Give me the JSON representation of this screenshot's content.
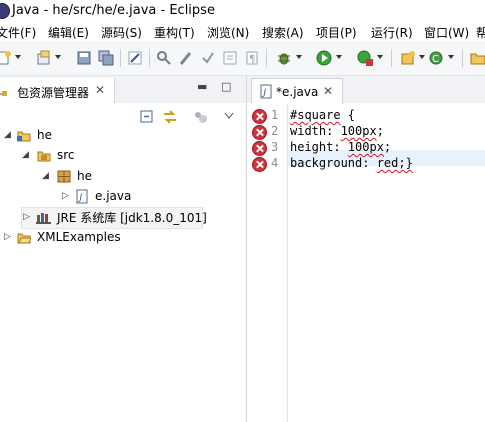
{
  "window": {
    "title": "Java - he/src/he/e.java - Eclipse"
  },
  "menu": [
    "文件(F)",
    "编辑(E)",
    "源码(S)",
    "重构(T)",
    "浏览(N)",
    "搜索(A)",
    "项目(P)",
    "运行(R)",
    "窗口(W)",
    "帮"
  ],
  "package_explorer": {
    "tab_label": "包资源管理器",
    "tree": {
      "project": "he",
      "src": "src",
      "package": "he",
      "file": "e.java",
      "jre": "JRE 系统库 [jdk1.8.0_101]",
      "other_project": "XMLExamples"
    }
  },
  "editor": {
    "tab_label": "*e.java",
    "lines": [
      {
        "num": "1",
        "pre": "",
        "squig": "#square",
        "post": " {"
      },
      {
        "num": "2",
        "pre": "width: ",
        "squig": "100px",
        "post": ";"
      },
      {
        "num": "3",
        "pre": "height: ",
        "squig": "100px",
        "post": ";"
      },
      {
        "num": "4",
        "pre": "background: ",
        "squig": "red;}",
        "post": ""
      }
    ]
  },
  "colors": {
    "error": "#d0323a",
    "current_line": "#e8f2fe",
    "toolbar_bg": "#f6f7f9"
  }
}
